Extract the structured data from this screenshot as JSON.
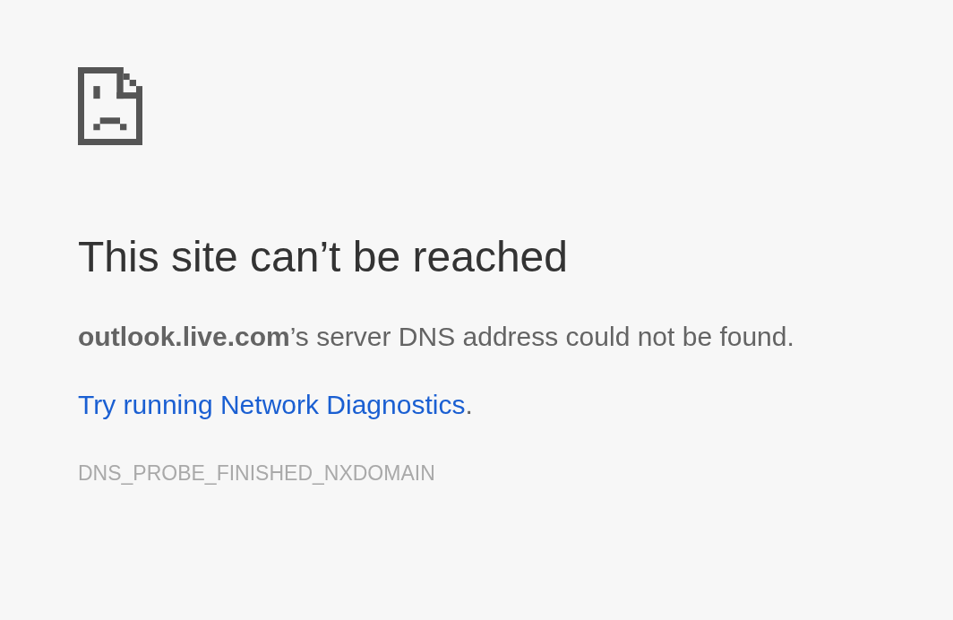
{
  "title": "This site can’t be reached",
  "message": "**outlook.live.com**’s server DNS address could not be found.",
  "suggestion": {
    "link": "Try running Network Diagnostics",
    "suffix": "."
  },
  "error_code": "DNS_PROBE_FINISHED_NXDOMAIN"
}
